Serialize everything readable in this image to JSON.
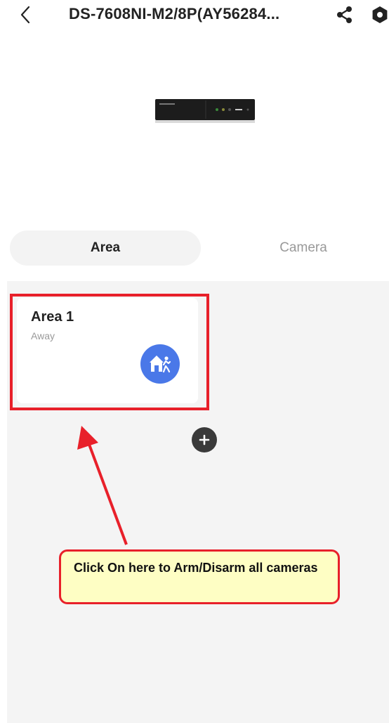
{
  "header": {
    "title": "DS-7608NI-M2/8P(AY56284...",
    "back_icon": "chevron-left-icon",
    "share_icon": "share-icon",
    "settings_icon": "settings-icon"
  },
  "device": {
    "image_icon": "nvr-device-image"
  },
  "tabs": [
    {
      "label": "Area",
      "active": true
    },
    {
      "label": "Camera",
      "active": false
    }
  ],
  "areas": [
    {
      "name": "Area 1",
      "status": "Away",
      "icon": "away-arm-icon"
    }
  ],
  "add_button": {
    "icon": "plus-icon"
  },
  "annotation": {
    "callout_text": "Click On here to Arm/Disarm all cameras"
  },
  "colors": {
    "accent_blue": "#4a78e8",
    "annotation_red": "#e8202a",
    "callout_bg": "#fefec4",
    "content_bg": "#f4f4f4"
  }
}
